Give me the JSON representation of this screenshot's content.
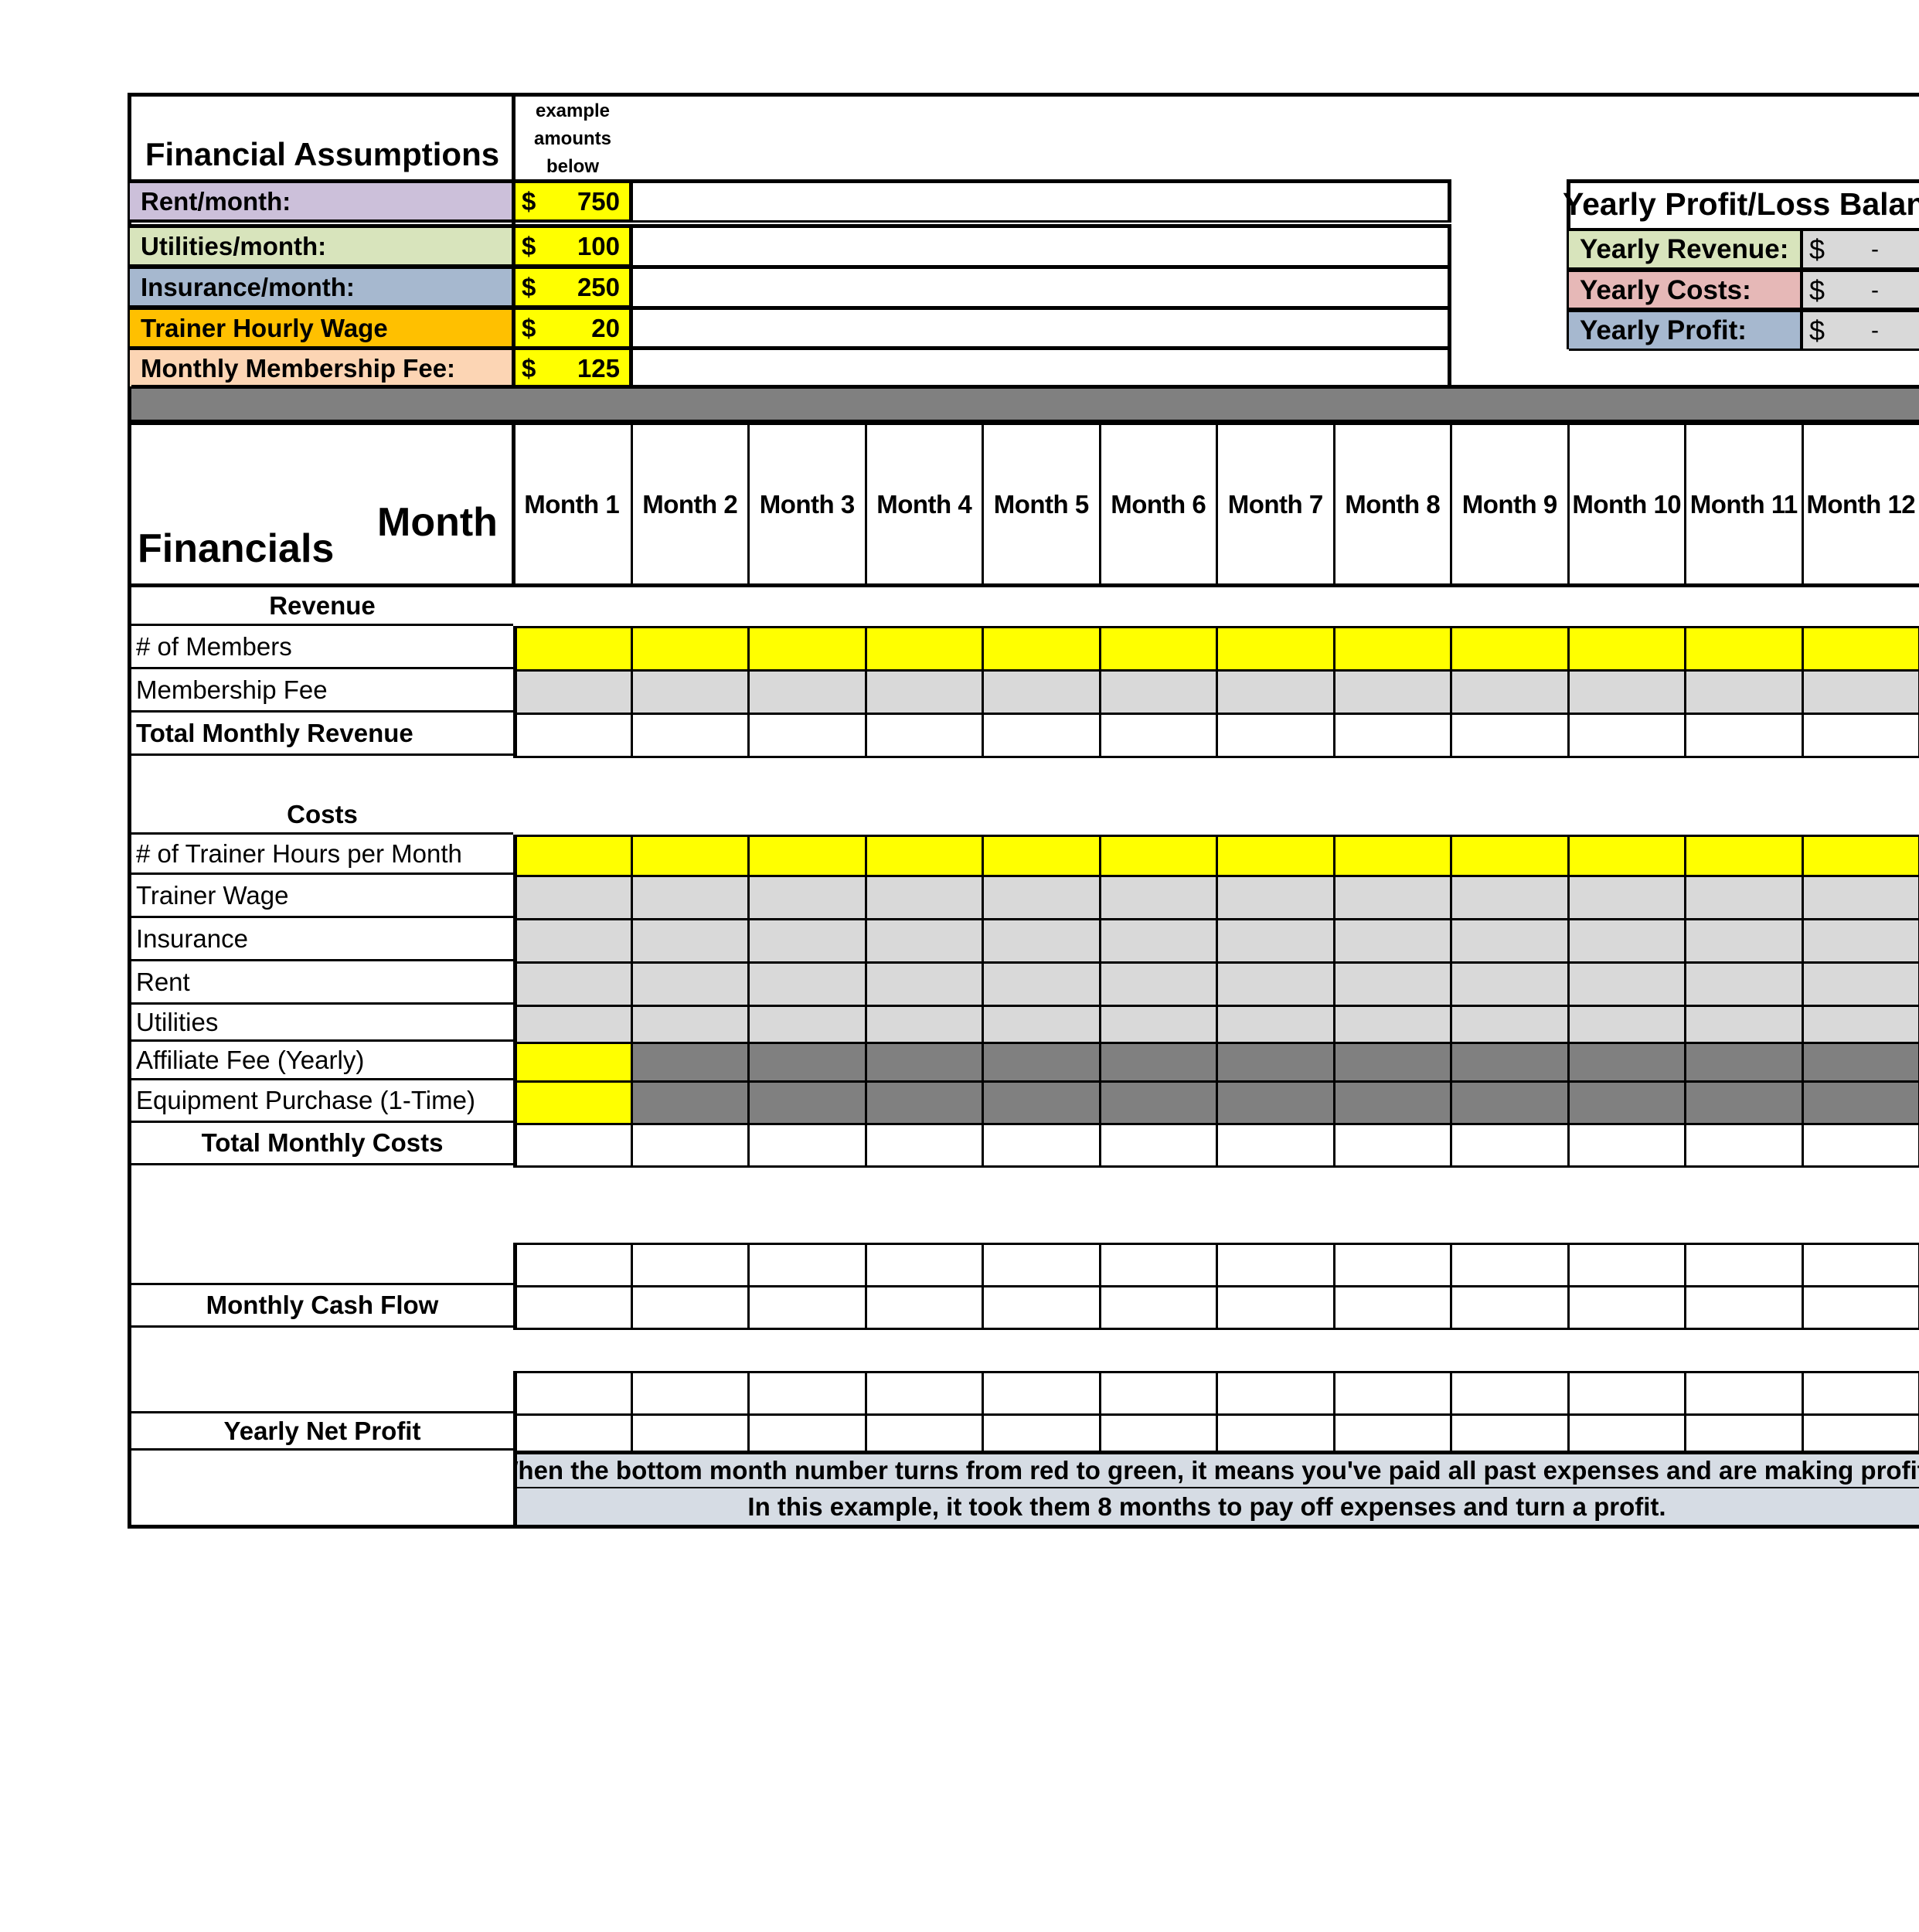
{
  "assumptions": {
    "title": "Financial Assumptions",
    "note": [
      "example",
      "amounts",
      "below"
    ],
    "rows": [
      {
        "label": "Rent/month:",
        "currency": "$",
        "value": "750",
        "color": "#ccc0da"
      },
      {
        "label": "Utilities/month:",
        "currency": "$",
        "value": "100",
        "color": "#d8e4bc"
      },
      {
        "label": "Insurance/month:",
        "currency": "$",
        "value": "250",
        "color": "#a6b8cf"
      },
      {
        "label": "Trainer Hourly Wage",
        "currency": "$",
        "value": "20",
        "color": "#ffc000"
      },
      {
        "label": "Monthly Membership Fee:",
        "currency": "$",
        "value": "125",
        "color": "#fcd5b4"
      }
    ]
  },
  "yearly": {
    "title": "Yearly Profit/Loss Balance",
    "rows": [
      {
        "label": "Yearly Revenue:",
        "currency": "$",
        "value": "-",
        "color": "#d8e4bc"
      },
      {
        "label": "Yearly Costs:",
        "currency": "$",
        "value": "-",
        "color": "#e6b8b7"
      },
      {
        "label": "Yearly Profit:",
        "currency": "$",
        "value": "-",
        "color": "#a6b8cf"
      }
    ]
  },
  "financials": {
    "title": "Financials",
    "month_label": "Month",
    "months": [
      "Month 1",
      "Month 2",
      "Month 3",
      "Month 4",
      "Month 5",
      "Month 6",
      "Month 7",
      "Month 8",
      "Month 9",
      "Month 10",
      "Month 11",
      "Month 12"
    ],
    "revenue_heading": "Revenue",
    "revenue_rows": [
      "# of Members",
      "Membership Fee",
      "Total Monthly Revenue"
    ],
    "costs_heading": "Costs",
    "cost_rows": [
      "# of Trainer Hours per Month",
      "Trainer Wage",
      "Insurance",
      "Rent",
      "Utilities",
      "Affiliate Fee (Yearly)",
      "Equipment Purchase (1-Time)"
    ],
    "total_costs": "Total Monthly Costs",
    "cash_flow": "Monthly Cash Flow",
    "net_profit": "Yearly Net Profit"
  },
  "notes": [
    "When the bottom month number turns from red to green, it means you've paid all past expenses and are making profit",
    "In this example, it took them 8 months to pay off expenses and turn a profit."
  ],
  "colors": {
    "input_yellow": "#ffff00",
    "formula_gray": "#d9d9d9",
    "disabled_gray": "#808080",
    "note_blue": "#d6dce4"
  }
}
